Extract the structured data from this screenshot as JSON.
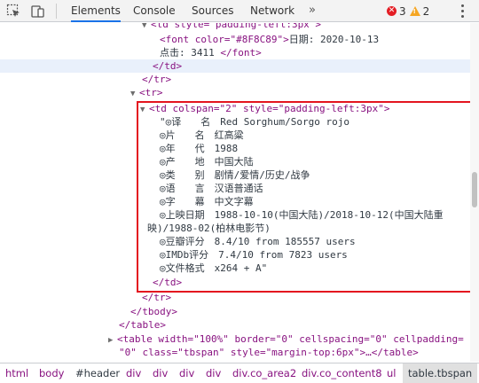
{
  "toolbar": {
    "tabs": [
      "Elements",
      "Console",
      "Sources",
      "Network"
    ],
    "more": "»",
    "error_count": "3",
    "warning_count": "2",
    "error_glyph": "✕",
    "warning_glyph": "!"
  },
  "code": {
    "l0_tag": "<td style=\"padding-left:3px\">",
    "l1_open": "<font color=\"#8F8C89\">",
    "l1_text": "日期: 2020-10-13",
    "l2_text": "点击: 3411 ",
    "l2_close": "</font>",
    "l3": "</td>",
    "l4": "</tr>",
    "l5": "<tr>",
    "l6_tag": "<td colspan=\"2\" style=\"padding-left:3px\">",
    "info": [
      "\"◎译　　名　Red Sorghum/Sorgo rojo",
      "◎片　　名　红高粱",
      "◎年　　代　1988",
      "◎产　　地　中国大陆",
      "◎类　　别　剧情/爱情/历史/战争",
      "◎语　　言　汉语普通话",
      "◎字　　幕　中文字幕",
      "◎上映日期　1988-10-10(中国大陆)/2018-10-12(中国大陆重",
      "映)/1988-02(柏林电影节)",
      "◎豆瓣评分　8.4/10 from 185557 users",
      "◎IMDb评分　7.4/10 from 7823 users",
      "◎文件格式　x264 + A\""
    ],
    "td_close": "</td>",
    "tr_close": "</tr>",
    "tbody_close": "</tbody>",
    "table_close": "</table>",
    "table_open_1": "<table width=\"100%\" border=\"0\" cellspacing=\"0\" cellpadding=",
    "table_open_2": "\"0\" class=\"tbspan\" style=\"margin-top:6px\">…</table>"
  },
  "breadcrumbs": [
    "html",
    "body",
    "#header",
    "div",
    "div",
    "div",
    "div",
    "div.co_area2",
    "div.co_content8",
    "ul",
    "table.tbspan"
  ],
  "colors": {
    "tag": "#881280",
    "attr_name": "#994500",
    "attr_value": "#1a1aa6",
    "highlight_box": "#e4151f",
    "active_tab": "#1a73e8"
  },
  "icons": [
    "inspect-element-icon",
    "device-toolbar-icon",
    "error-icon",
    "warning-icon",
    "more-options-icon"
  ]
}
